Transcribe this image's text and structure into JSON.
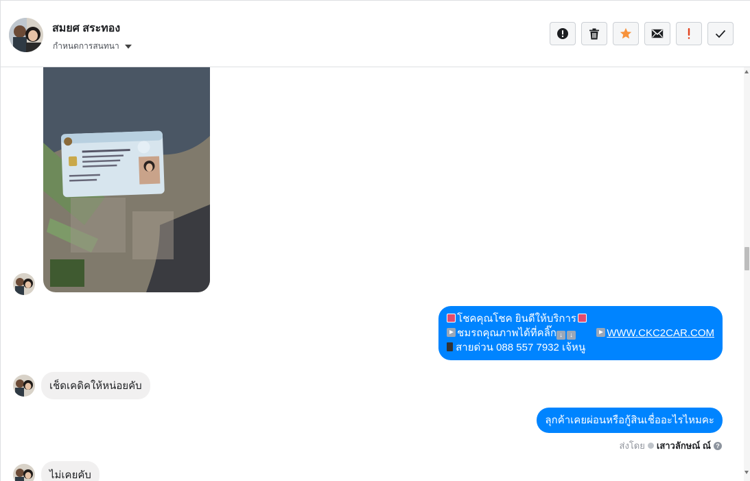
{
  "header": {
    "contact_name": "สมยศ สระทอง",
    "conversation_menu": "กำหนดการสนทนา",
    "actions": [
      {
        "icon": "alert-circle-icon",
        "color": "#1c1e21"
      },
      {
        "icon": "trash-icon",
        "color": "#1c1e21"
      },
      {
        "icon": "star-icon",
        "color": "#f7923b"
      },
      {
        "icon": "envelope-icon",
        "color": "#1c1e21"
      },
      {
        "icon": "exclamation-icon",
        "color": "#e2401c"
      },
      {
        "icon": "checkmark-icon",
        "color": "#1c1e21"
      }
    ]
  },
  "messages": [
    {
      "from": "contact",
      "type": "image",
      "description_icon": "id-card-photo"
    },
    {
      "from": "page",
      "type": "text",
      "line1": "โชคคุณโชค ยินดีให้บริการ",
      "line2": "ชมรถคุณภาพได้ที่คลิ๊ก",
      "link": "WWW.CKC2CAR.COM",
      "line3": "สายด่วน 088 557 7932 เจ้หนู"
    },
    {
      "from": "contact",
      "type": "text",
      "text": "เช็ดเคดิคให้หน่อยคับ"
    },
    {
      "from": "page",
      "type": "text",
      "text": "ลุกค้าเคยผ่อนหรือกู้สินเชื่ออะไรไหมคะ"
    },
    {
      "from": "contact",
      "type": "text",
      "text": "ไม่เคยคับ"
    }
  ],
  "sent_by": {
    "label": "ส่งโดย",
    "name": "เสาวลักษณ์ ณ์",
    "help": "?"
  },
  "colors": {
    "outgoing_bubble": "#0084ff",
    "incoming_bubble": "#f1f0f0"
  }
}
